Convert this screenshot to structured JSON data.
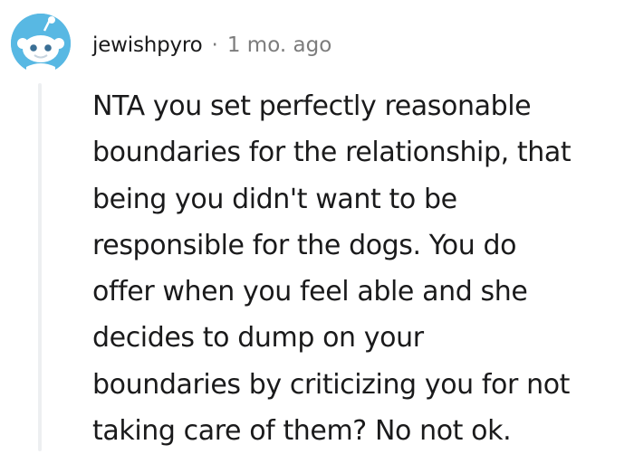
{
  "comment": {
    "author": "jewishpyro",
    "separator": "·",
    "timestamp": "1 mo. ago",
    "avatar_icon": "reddit-snoo-avatar-icon",
    "body_lines": [
      "NTA you set perfectly reasonable",
      "boundaries for the relationship, that",
      "being you didn't want to be",
      "responsible for the dogs. You do",
      "offer when you feel able and she",
      "decides to dump on your",
      "boundaries by criticizing you for not",
      "taking care of them? No not ok."
    ]
  },
  "colors": {
    "text": "#1a1a1b",
    "meta": "#7c7c7c",
    "avatar_bg": "#46d160",
    "thread_line": "#edeff1"
  }
}
